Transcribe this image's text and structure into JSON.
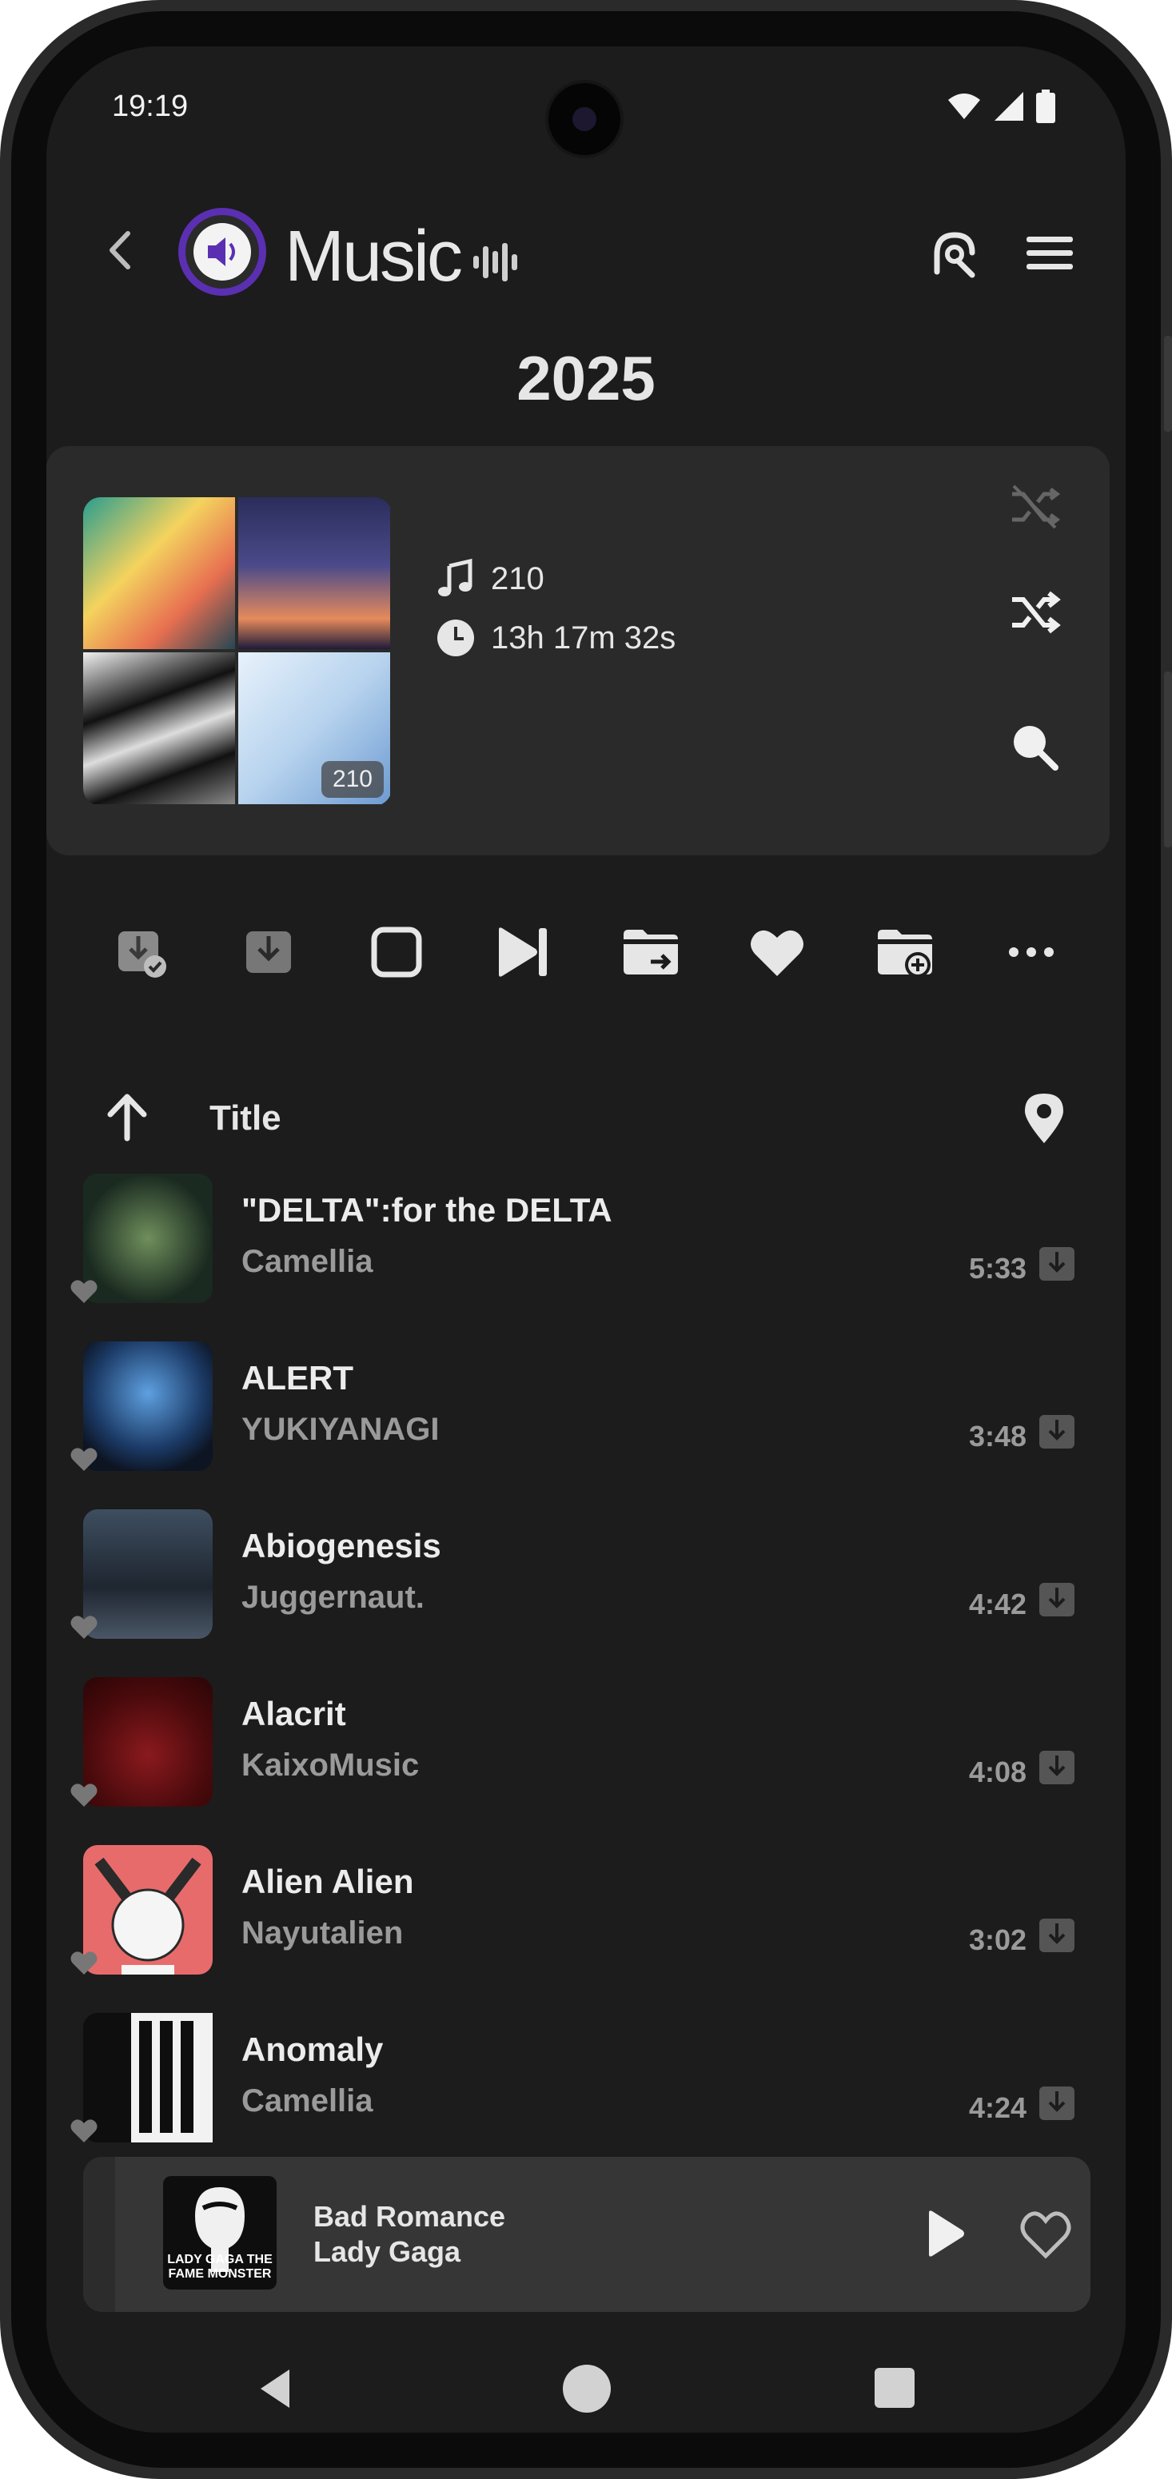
{
  "status": {
    "time": "19:19",
    "icons": [
      "wifi-icon",
      "signal-icon",
      "battery-icon"
    ]
  },
  "appbar": {
    "title": "Music",
    "icons": [
      "back-icon",
      "app-logo",
      "audio-wave-icon",
      "ar-search-icon",
      "menu-icon"
    ]
  },
  "playlist": {
    "year": "2025",
    "track_count": "210",
    "duration": "13h 17m 32s",
    "collage_count": "210",
    "card_actions": [
      "shuffle-off-icon",
      "shuffle-icon",
      "search-icon"
    ]
  },
  "toolbar": {
    "icons": [
      "downloaded-check-icon",
      "download-icon",
      "stop-icon",
      "play-next-icon",
      "move-to-folder-icon",
      "favorite-icon",
      "add-to-folder-icon",
      "more-icon"
    ]
  },
  "sort": {
    "label": "Title"
  },
  "songs": [
    {
      "title": "\"DELTA\":for the DELTA",
      "artist": "Camellia",
      "duration": "5:33",
      "color": "#1f3a2c"
    },
    {
      "title": "ALERT",
      "artist": "YUKIYANAGI",
      "duration": "3:48",
      "color": "#21456e"
    },
    {
      "title": "Abiogenesis",
      "artist": "Juggernaut.",
      "duration": "4:42",
      "color": "#2e3b4b"
    },
    {
      "title": "Alacrit",
      "artist": "KaixoMusic",
      "duration": "4:08",
      "color": "#5c0f12"
    },
    {
      "title": "Alien Alien",
      "artist": "Nayutalien",
      "duration": "3:02",
      "color": "#e86b6b"
    },
    {
      "title": "Anomaly",
      "artist": "Camellia",
      "duration": "4:24",
      "color": "#111111"
    }
  ],
  "now_playing": {
    "title": "Bad Romance",
    "artist": "Lady Gaga",
    "art_text": "LADY GAGA THE FAME MONSTER"
  },
  "nav": {
    "icons": [
      "nav-back-icon",
      "nav-home-icon",
      "nav-recents-icon"
    ]
  }
}
